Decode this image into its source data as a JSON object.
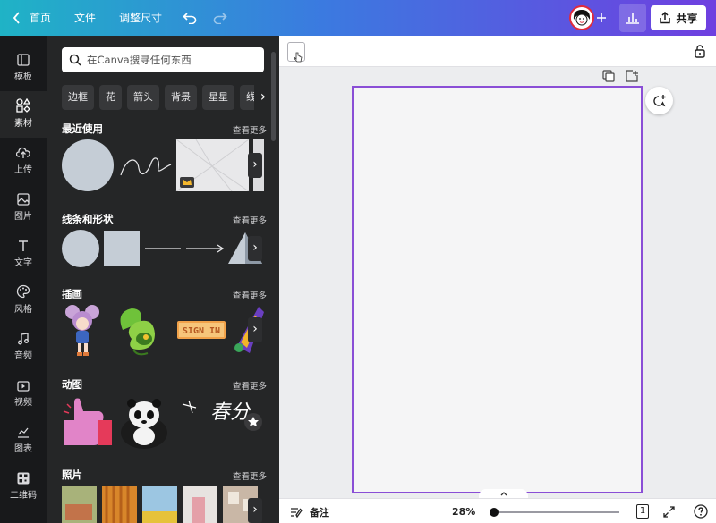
{
  "topbar": {
    "home_label": "首页",
    "file_label": "文件",
    "resize_label": "调整尺寸",
    "share_label": "共享"
  },
  "rail": {
    "items": [
      {
        "label": "模板",
        "icon": "template-icon"
      },
      {
        "label": "素材",
        "icon": "elements-icon"
      },
      {
        "label": "上传",
        "icon": "upload-icon"
      },
      {
        "label": "图片",
        "icon": "photo-icon"
      },
      {
        "label": "文字",
        "icon": "text-icon"
      },
      {
        "label": "风格",
        "icon": "style-icon"
      },
      {
        "label": "音频",
        "icon": "audio-icon"
      },
      {
        "label": "视频",
        "icon": "video-icon"
      },
      {
        "label": "图表",
        "icon": "chart-icon"
      },
      {
        "label": "二维码",
        "icon": "qrcode-icon"
      }
    ],
    "active": "素材"
  },
  "panel": {
    "search_placeholder": "在Canva搜寻任何东西",
    "chips": [
      "边框",
      "花",
      "箭头",
      "背景",
      "星星",
      "线条"
    ],
    "see_more": "查看更多",
    "sections": [
      "最近使用",
      "线条和形状",
      "插画",
      "动图",
      "照片"
    ],
    "illustration_text": "SIGN IN",
    "calligraphy_text": "春分"
  },
  "bottombar": {
    "notes_label": "备注",
    "zoom_label": "28%",
    "page_count": "1"
  },
  "colors": {
    "accent": "#8a4ed6",
    "panel_bg": "#252627",
    "rail_bg": "#18191b",
    "shape_fill": "#c5cdd6"
  }
}
